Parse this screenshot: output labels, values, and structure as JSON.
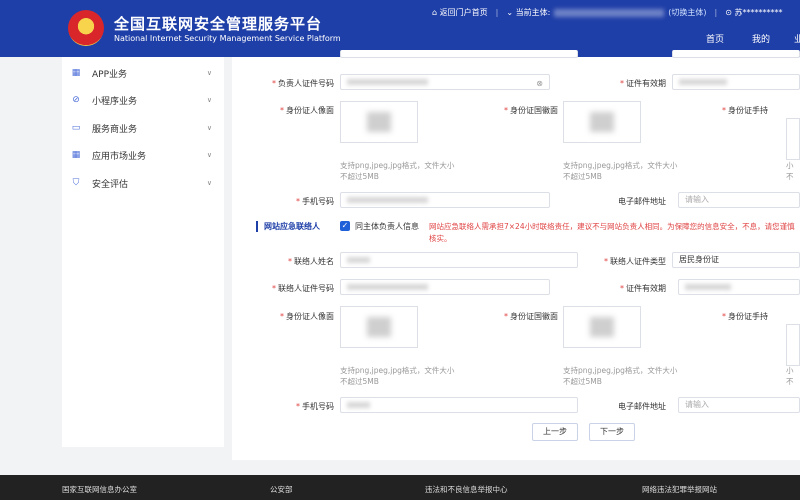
{
  "header": {
    "title_cn": "全国互联网安全管理服务平台",
    "title_en": "National Internet Security Management Service Platform",
    "back_portal": "返回门户首页",
    "subject_label": "当前主体:",
    "switch_subject": "(切换主体)",
    "user": "苏**********",
    "nav_home": "首页",
    "nav_mine": "我的",
    "nav_more": "业"
  },
  "sidebar": {
    "items": [
      {
        "label": "APP业务",
        "icon": "grid-icon"
      },
      {
        "label": "小程序业务",
        "icon": "compass-icon"
      },
      {
        "label": "服务商业务",
        "icon": "monitor-icon"
      },
      {
        "label": "应用市场业务",
        "icon": "grid-icon"
      },
      {
        "label": "安全评估",
        "icon": "shield-icon"
      }
    ]
  },
  "form": {
    "principal": {
      "id_number_label": "负责人证件号码",
      "id_validity_label": "证件有效期",
      "id_portrait_label": "身份证人像面",
      "id_emblem_label": "身份证国徽面",
      "id_handheld_label": "身份证手持",
      "upload_hint": "支持png,jpeg,jpg格式，文件大小不超过5MB",
      "phone_label": "手机号码",
      "email_label": "电子邮件地址",
      "email_placeholder": "请输入"
    },
    "emergency": {
      "section_title": "网站应急联络人",
      "same_as_principal": "同主体负责人信息",
      "warning": "网站应急联络人需承担7×24小时联络责任，建议不与网站负责人相同。为保障您的信息安全，不息，请您谨慎核实。",
      "name_label": "联络人姓名",
      "id_type_label": "联络人证件类型",
      "id_type_value": "居民身份证",
      "id_number_label": "联络人证件号码",
      "id_validity_label": "证件有效期",
      "id_portrait_label": "身份证人像面",
      "id_emblem_label": "身份证国徽面",
      "id_handheld_label": "身份证手持",
      "upload_hint": "支持png,jpeg,jpg格式，文件大小不超过5MB",
      "phone_label": "手机号码",
      "email_label": "电子邮件地址",
      "email_placeholder": "请输入"
    },
    "prev_button": "上一步",
    "next_button": "下一步",
    "hint_overflow": "小不"
  },
  "footer": {
    "links": [
      "国家互联网信息办公室",
      "公安部",
      "违法和不良信息举报中心",
      "网络违法犯罪举报网站"
    ]
  }
}
